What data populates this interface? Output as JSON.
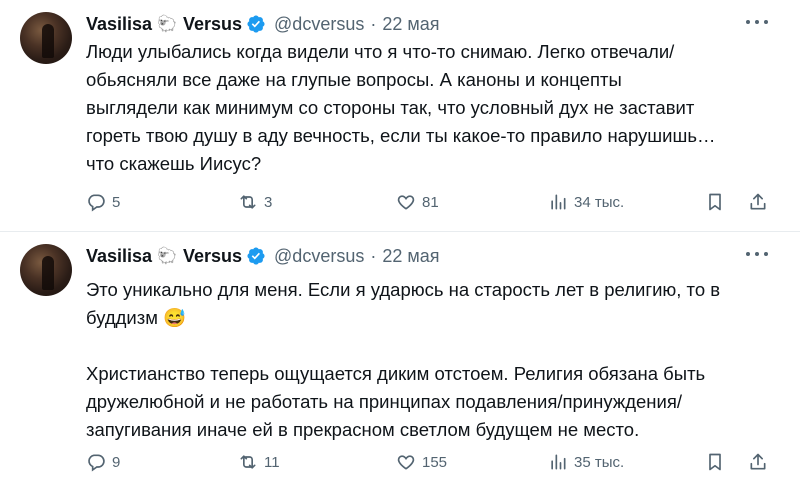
{
  "tweets": [
    {
      "author": {
        "name": "Vasilisa",
        "sheep": "🐑",
        "name2": "Versus",
        "handle": "@dcversus",
        "dot": "·",
        "date": "22 мая"
      },
      "text": [
        "Люди улыбались когда видели что я что-то снимаю. Легко отвечали/",
        "обьясняли все даже на глупые вопросы. А каноны и концепты",
        "выглядели как минимум со стороны так, что условный дух не заставит",
        "гореть твою душу в аду вечность, если ты какое-то правило нарушишь…",
        "что скажешь Иисус?"
      ],
      "actions": {
        "replies": "5",
        "reposts": "3",
        "likes": "81",
        "views": "34 тыс."
      }
    },
    {
      "author": {
        "name": "Vasilisa",
        "sheep": "🐑",
        "name2": "Versus",
        "handle": "@dcversus",
        "dot": "·",
        "date": "22 мая"
      },
      "text": [
        "Это уникально для меня. Если я ударюсь на старость лет в религию, то в",
        "буддизм 😅",
        "",
        "Христианство теперь ощущается диким отстоем. Религия обязана быть",
        "дружелюбной и не работать на принципах подавления/принуждения/",
        "запугивания иначе ей в прекрасном светлом будущем не место."
      ],
      "actions": {
        "replies": "9",
        "reposts": "11",
        "likes": "155",
        "views": "35 тыс."
      }
    }
  ],
  "colors": {
    "text": "#0f1419",
    "muted": "#536471",
    "verified": "#1d9bf0",
    "separator": "#e8ecef"
  },
  "icons": [
    "reply-icon",
    "repost-icon",
    "like-icon",
    "views-icon",
    "bookmark-icon",
    "share-icon",
    "more-icon",
    "verified-badge-icon"
  ]
}
